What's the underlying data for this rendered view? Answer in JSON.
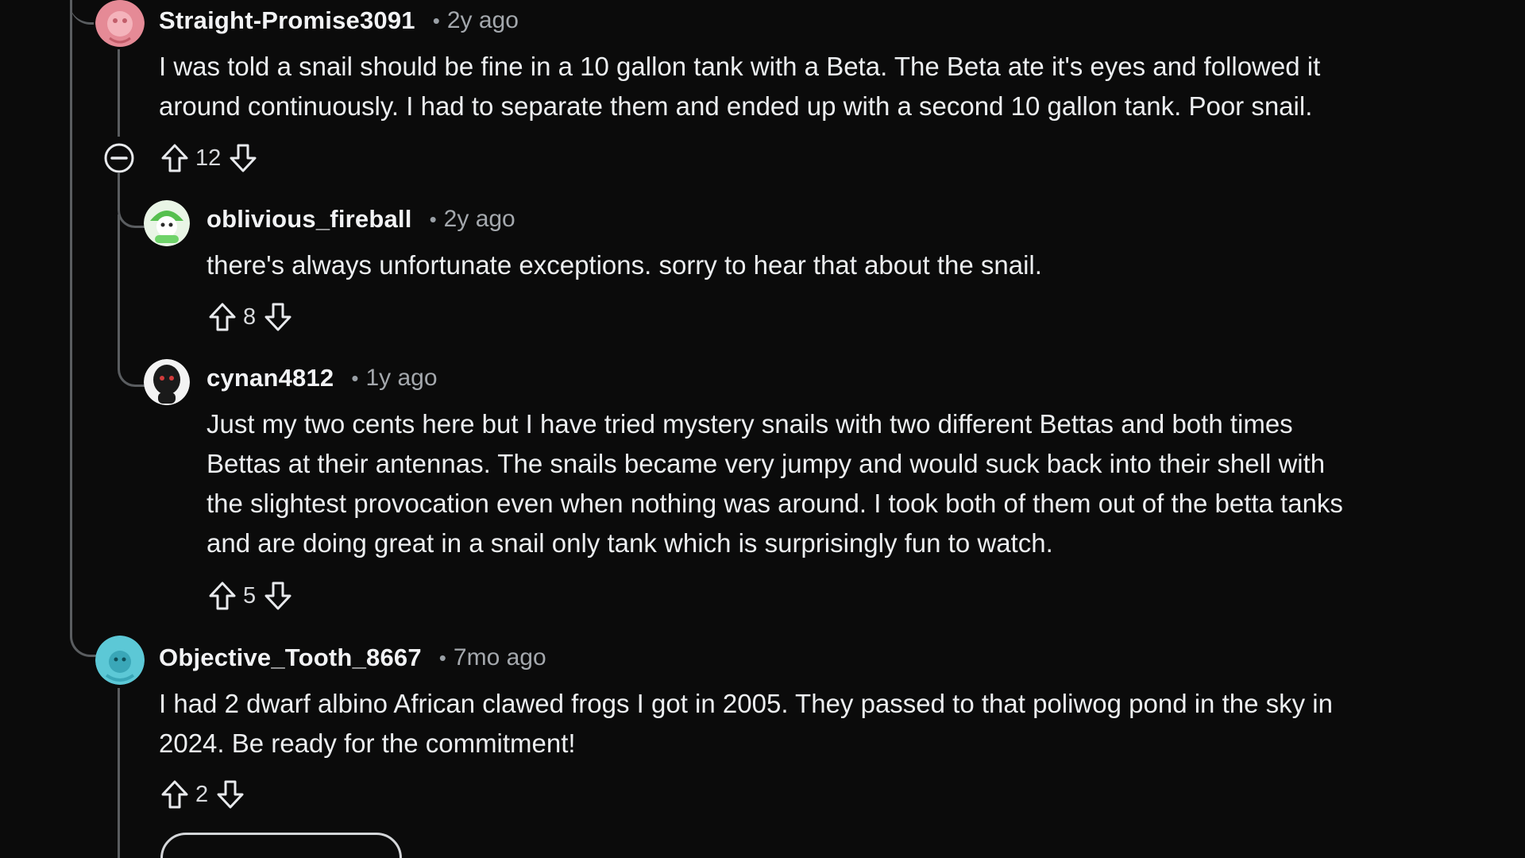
{
  "comments": [
    {
      "username": "Straight-Promise3091",
      "separator": "•",
      "time": "2y ago",
      "body": "I was told a snail should be fine in a 10 gallon tank with a Beta. The Beta ate it's eyes and followed it\naround continuously. I had to separate them and ended up with a second 10 gallon tank. Poor snail.",
      "score": "12",
      "avatar_color": "#e58a96"
    },
    {
      "username": "oblivious_fireball",
      "separator": "•",
      "time": "2y ago",
      "body": "there's always unfortunate exceptions. sorry to hear that about the snail.",
      "score": "8",
      "avatar_color": "#6fd36a"
    },
    {
      "username": "cynan4812",
      "separator": "•",
      "time": "1y ago",
      "body": "Just my two cents here but I have tried mystery snails with two different Bettas and both times\nBettas at their antennas. The snails became very jumpy and would suck back into their shell with\nthe slightest provocation even when nothing was around. I took both of them out of the betta tanks\nand are doing great in a snail only tank which is surprisingly fun to watch.",
      "score": "5",
      "avatar_color": "#f0f0f0"
    },
    {
      "username": "Objective_Tooth_8667",
      "separator": "•",
      "time": "7mo ago",
      "body": "I had 2 dwarf albino African clawed frogs I got in 2005. They passed to that poliwog pond in the sky in\n2024. Be ready for the commitment!",
      "score": "2",
      "avatar_color": "#5cc8d6"
    }
  ],
  "icons": {
    "upvote": "arrow-up-outline-icon",
    "downvote": "arrow-down-outline-icon",
    "collapse": "minus-circle-icon"
  },
  "colors": {
    "background": "#0b0b0b",
    "thread_line": "#5a5d60",
    "text": "#eceef0",
    "muted": "#a4a8ad"
  }
}
